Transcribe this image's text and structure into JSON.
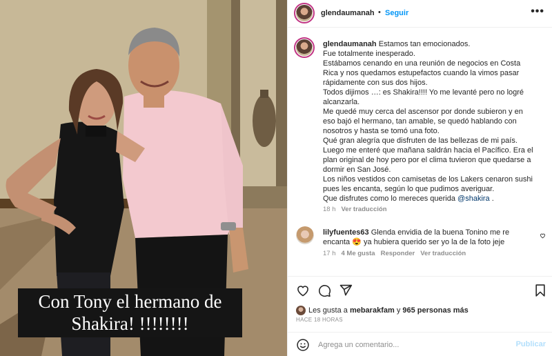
{
  "post": {
    "username": "glendaumanah",
    "follow_label": "Seguir",
    "separator": "•",
    "more_label": "•••",
    "image_caption_lines": [
      "Con Tony el hermano de",
      "Shakira! !!!!!!!!"
    ],
    "caption_lines": [
      "Estamos tan emocionados.",
      "Fue totalmente inesperado.",
      "Estábamos cenando en una reunión de negocios en Costa",
      "Rica y nos quedamos estupefactos cuando la vimos pasar",
      "rápidamente con sus dos hijos.",
      "Todos dijimos …: es Shakira!!!! Yo me levanté pero no logré",
      "alcanzarla.",
      "Me quedé muy cerca del ascensor por donde subieron y en",
      "eso bajó el hermano, tan amable, se quedó hablando con",
      "nosotros y hasta se tomó una foto.",
      "Qué gran alegría que disfruten de las bellezas de mi país.",
      "Luego me enteré que mañana saldrán hacia el Pacífico. Era el",
      "plan original de hoy pero por el clima tuvieron que quedarse a",
      "dormir en San José.",
      "Los niños vestidos con camisetas de los Lakers cenaron sushi",
      "pues les encanta, según lo que pudimos averiguar."
    ],
    "caption_last_prefix": "Que disfrutes como lo mereces querida ",
    "caption_mention": "@shakira",
    "caption_last_suffix": " .",
    "time_ago": "18 h",
    "see_translation": "Ver traducción"
  },
  "comment": {
    "username": "lilyfuentes63",
    "text_line1": "Glenda envidia de la buena Tonino me re",
    "text_line2": "encanta 😍 ya hubiera querido ser yo la de la foto jeje",
    "time_ago": "17 h",
    "likes": "4 Me gusta",
    "reply": "Responder",
    "see_translation": "Ver traducción"
  },
  "engagement": {
    "likes_prefix": "Les gusta a ",
    "likes_user": "mebarakfam",
    "likes_middle": " y ",
    "likes_count": "965 personas más",
    "posted_ago": "HACE 18 HORAS"
  },
  "add_comment": {
    "placeholder": "Agrega un comentario...",
    "publish_label": "Publicar"
  },
  "icons": {
    "like": "heart-icon",
    "comment": "comment-icon",
    "share": "send-icon",
    "save": "bookmark-icon",
    "emoji": "emoji-icon",
    "more": "more-icon"
  },
  "colors": {
    "follow_blue": "#0095f6",
    "mention_blue": "#00376b",
    "muted_gray": "#8e8e8e",
    "publish_disabled": "#b2dffc",
    "story_ring": "#c13584"
  }
}
